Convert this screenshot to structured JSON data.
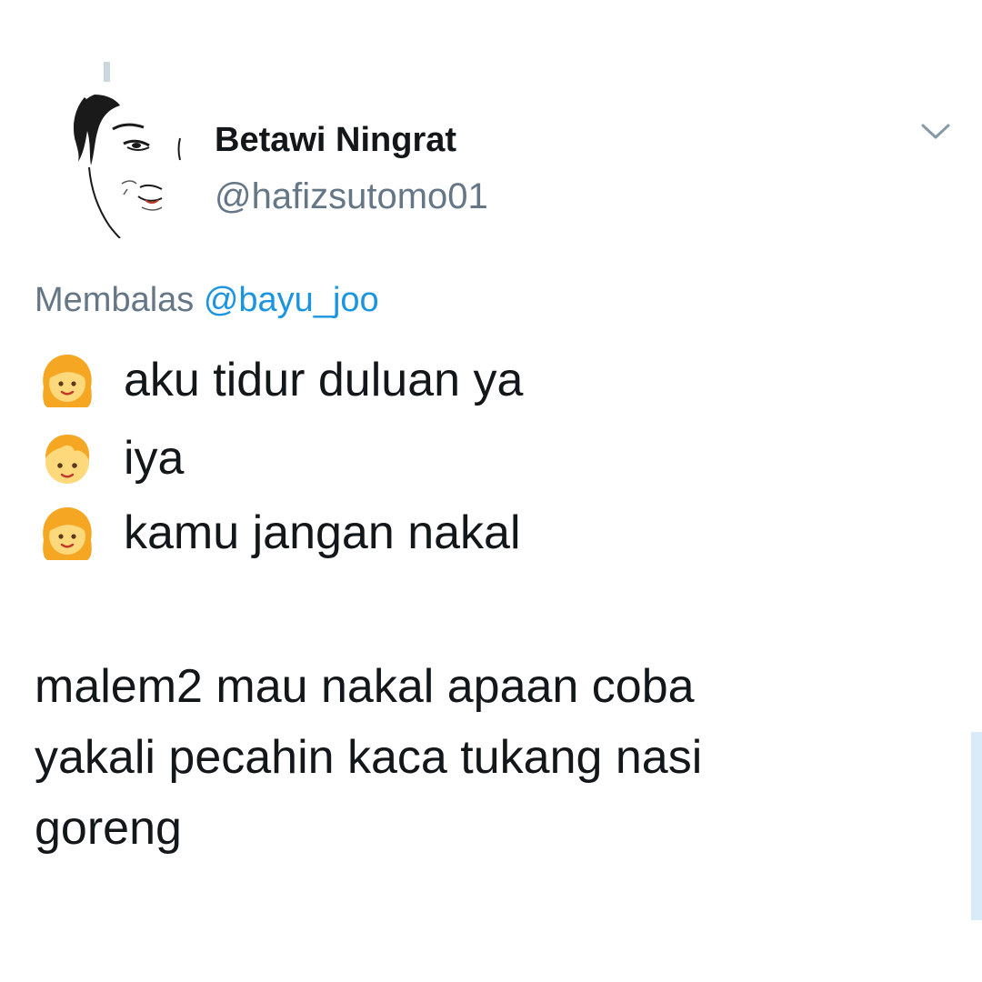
{
  "tweet": {
    "display_name": "Betawi Ningrat",
    "handle": "@hafizsutomo01",
    "reply_prefix": "Membalas ",
    "reply_mention": "@bayu_joo",
    "conversation": [
      {
        "speaker_icon": "girl-emoji-icon",
        "text": "aku tidur duluan ya"
      },
      {
        "speaker_icon": "boy-emoji-icon",
        "text": "iya"
      },
      {
        "speaker_icon": "girl-emoji-icon",
        "text": "kamu jangan nakal"
      }
    ],
    "caption_lines": [
      "malem2 mau nakal apaan coba",
      "yakali pecahin kaca tukang nasi",
      "goreng"
    ]
  },
  "icons": {
    "avatar": "sketch-face-avatar",
    "menu": "chevron-down-icon"
  },
  "colors": {
    "primary_text": "#14171a",
    "secondary_text": "#657786",
    "link": "#1b95e0",
    "thread_line": "#ccd6dd",
    "scroll_indicator": "#d9ebf9"
  }
}
